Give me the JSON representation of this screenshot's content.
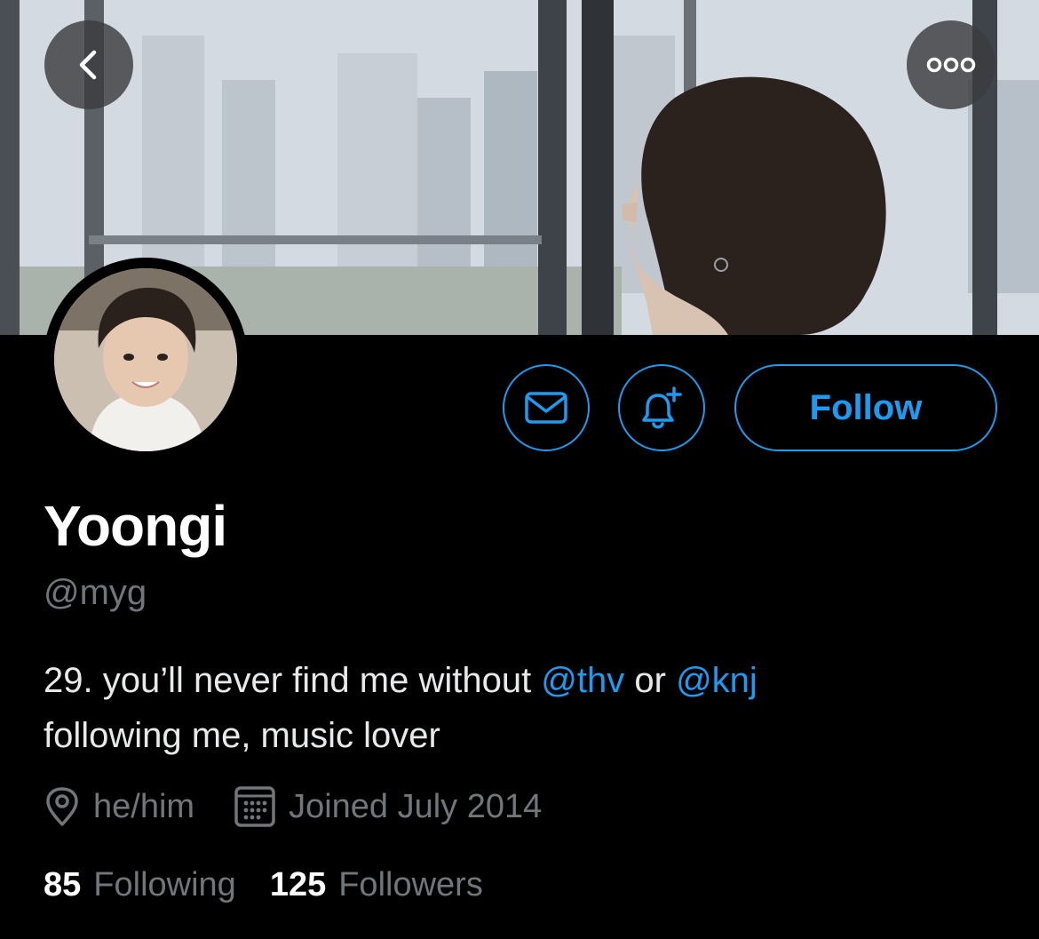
{
  "header": {
    "back_icon": "chevron-left-icon",
    "more_icon": "more-horizontal-icon"
  },
  "profile": {
    "display_name": "Yoongi",
    "handle": "@myg",
    "bio": {
      "text_1": "29. you’ll never find me without ",
      "mention_1": "@thv",
      "text_2": " or ",
      "mention_2": "@knj",
      "text_3": "following me, music lover"
    },
    "location": "he/him",
    "joined": "Joined July 2014"
  },
  "actions": {
    "message_icon": "mail-icon",
    "notify_icon": "bell-plus-icon",
    "follow_label": "Follow"
  },
  "stats": {
    "following_count": "85",
    "following_label": "Following",
    "followers_count": "125",
    "followers_label": "Followers"
  },
  "colors": {
    "accent": "#1d9bf0",
    "secondary_text": "#71767b",
    "background": "#000000"
  }
}
